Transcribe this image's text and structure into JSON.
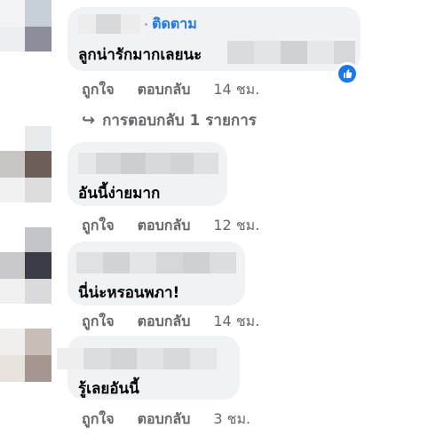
{
  "comments": [
    {
      "follow_label": "ติดตาม",
      "follow_sep": "·",
      "text": "ลูกน่ารักมากเลยนะ",
      "like_label": "ถูกใจ",
      "reply_label": "ตอบกลับ",
      "time": "14 ชม.",
      "reaction": "like-icon"
    },
    {
      "text": "อันนี้ง่ายมาก",
      "like_label": "ถูกใจ",
      "reply_label": "ตอบกลับ",
      "time": "12 ชม."
    },
    {
      "text": "นี่น่ะหรอนพภา!",
      "like_label": "ถูกใจ",
      "reply_label": "ตอบกลับ",
      "time": "14 ชม."
    },
    {
      "text": "รู้เลยอันนี้",
      "like_label": "ถูกใจ",
      "reply_label": "ตอบกลับ",
      "time": "3 ชม."
    }
  ],
  "replies_link": {
    "icon": "reply-arrow-icon",
    "label": "การตอบกลับ 1 รายการ"
  },
  "colors": {
    "bubble": "#f0f2f5",
    "accent": "#1877f2",
    "secondary_text": "#65676b"
  }
}
